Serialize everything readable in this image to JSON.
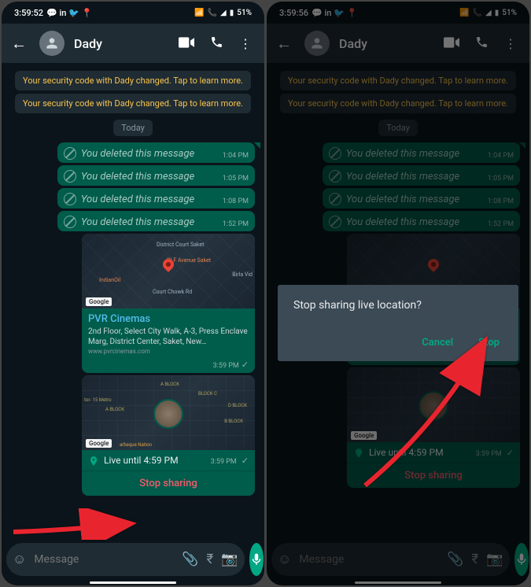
{
  "status": {
    "time_left": "3:59:52",
    "time_right": "3:59:56",
    "battery": "51%",
    "icons_left": "● in ✕ ⬤",
    "icons_right": "▾ ⇅ ◢ ◣"
  },
  "header": {
    "contact": "Dady"
  },
  "chat": {
    "security_notice": "Your security code with Dady changed. Tap to learn more.",
    "date": "Today",
    "deleted_text": "You deleted this message",
    "deleted_times": [
      "1:04 PM",
      "1:05 PM",
      "1:08 PM",
      "1:52 PM"
    ],
    "location": {
      "title": "PVR Cinemas",
      "address": "2nd Floor, Select City Walk, A-3, Press Enclave Marg, District Center, Saket, New…",
      "url": "www.pvrcinemas.com",
      "time": "3:59 PM",
      "google": "Google",
      "district_court": "District Court Saket",
      "dlf": "DLF Avenue Saket",
      "indianoil": "IndianOil",
      "court_chowk": "Court Chowk Rd",
      "birla": "Birla Vid"
    },
    "live": {
      "status": "Live until 4:59 PM",
      "time": "3:59 PM",
      "stop": "Stop sharing",
      "google": "Google",
      "barbeque": "arbeque Nation",
      "block_a": "A BLOCK",
      "block_b": "B BLOCK",
      "block_c": "BLOCK C",
      "block_d": "D BLOCK",
      "sector15": "tor- 15 Metro"
    }
  },
  "input": {
    "placeholder": "Message"
  },
  "dialog": {
    "title": "Stop sharing live location?",
    "cancel": "Cancel",
    "stop": "Stop"
  }
}
